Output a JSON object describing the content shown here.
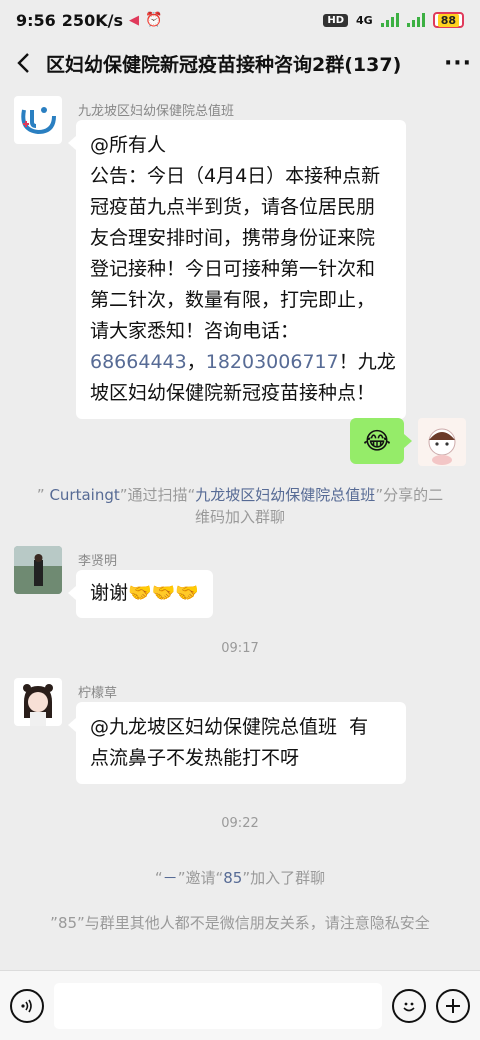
{
  "status_bar": {
    "time": "9:56",
    "speed": "250K/s",
    "hd": "HD",
    "network": "4G",
    "battery": "88"
  },
  "header": {
    "back_icon": "chevron-left-icon",
    "title": "区妇幼保健院新冠疫苗接种咨询2群(137)",
    "more_icon": "ellipsis-icon"
  },
  "messages": {
    "m1": {
      "sender": "九龙坡区妇幼保健院总值班",
      "lines": [
        "@所有人",
        "公告：今日（4月4日）本接种点新",
        "冠疫苗九点半到货，请各位居民朋",
        "友合理安排时间，携带身份证来院",
        "登记接种！今日可接种第一针次和",
        "第二针次，数量有限，打完即止，",
        "请大家悉知！咨询电话："
      ],
      "phone1": "68664443",
      "sep": "，",
      "phone2": "18203006717",
      "tail1": "！九龙",
      "last_line": "坡区妇幼保健院新冠疫苗接种点！"
    },
    "m2": {
      "emoji": "😂",
      "emoji_name": "crying-laughing-emoji"
    },
    "sys1": {
      "q1": "” ",
      "name": "Curtaingt",
      "mid": "”通过扫描“",
      "group": "九龙坡区妇幼保健院总值班",
      "end": "”分享的二维码加入群聊"
    },
    "m3": {
      "sender": "李贤明",
      "text": "谢谢🤝🤝🤝"
    },
    "time1": "09:17",
    "m4": {
      "sender": "柠檬草",
      "line1": "@九龙坡区妇幼保健院总值班  有",
      "line2": "点流鼻子不发热能打不呀"
    },
    "time2": "09:22",
    "sys2": {
      "q1": "“",
      "inviter": "－",
      "mid": "”邀请“",
      "invitee": "85",
      "end": "”加入了群聊"
    },
    "sys3": "”85”与群里其他人都不是微信朋友关系，请注意隐私安全"
  },
  "input_bar": {
    "voice_icon": "voice-icon",
    "emoji_icon": "emoji-icon",
    "plus_icon": "plus-icon"
  }
}
